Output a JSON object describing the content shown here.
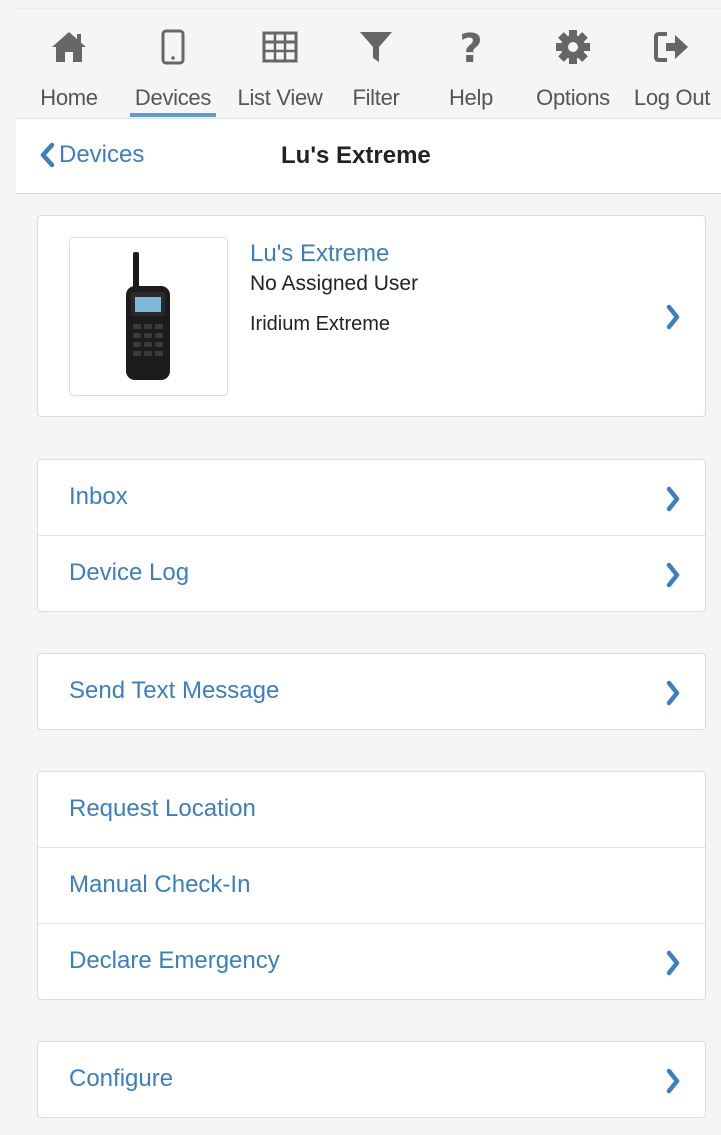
{
  "nav": [
    {
      "label": "Home",
      "icon": "home-icon"
    },
    {
      "label": "Devices",
      "icon": "mobile-device-icon",
      "active": true
    },
    {
      "label": "List View",
      "icon": "table-grid-icon"
    },
    {
      "label": "Filter",
      "icon": "filter-funnel-icon"
    },
    {
      "label": "Help",
      "icon": "question-mark-icon"
    },
    {
      "label": "Options",
      "icon": "gear-icon"
    },
    {
      "label": "Log Out",
      "icon": "sign-out-icon"
    }
  ],
  "header": {
    "back_label": "Devices",
    "title": "Lu's Extreme"
  },
  "device": {
    "name": "Lu's Extreme",
    "user": "No Assigned User",
    "model": "Iridium Extreme"
  },
  "groups": {
    "messages": {
      "inbox": "Inbox",
      "device_log": "Device Log"
    },
    "send": {
      "send_text": "Send Text Message"
    },
    "actions": {
      "request_location": "Request Location",
      "manual_checkin": "Manual Check-In",
      "declare_emergency": "Declare Emergency"
    },
    "settings": {
      "configure": "Configure"
    }
  },
  "colors": {
    "accent": "#3b7fc0",
    "active_underline": "#5a9bd5",
    "icon": "#666666",
    "background": "#f5f5f5"
  }
}
